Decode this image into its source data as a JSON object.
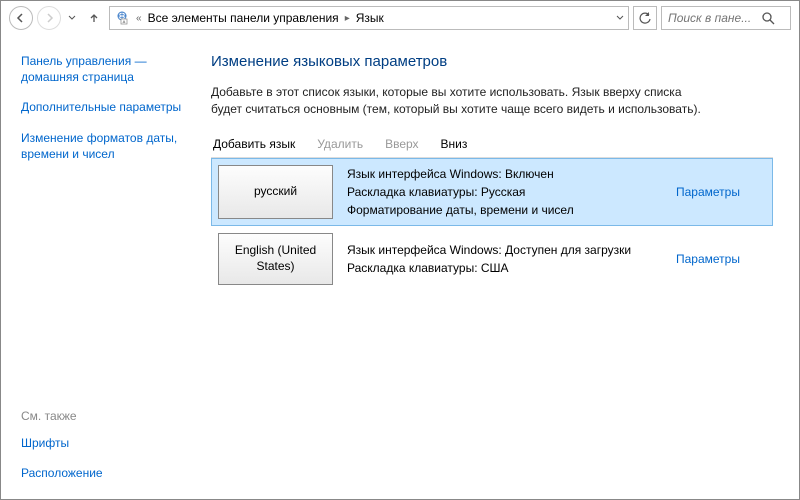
{
  "addressbar": {
    "segment1": "Все элементы панели управления",
    "segment2": "Язык",
    "search_placeholder": "Поиск в пане..."
  },
  "sidebar": {
    "home": "Панель управления — домашняя страница",
    "adv": "Дополнительные параметры",
    "fmt": "Изменение форматов даты, времени и чисел",
    "seealso": "См. также",
    "fonts": "Шрифты",
    "location": "Расположение"
  },
  "main": {
    "title": "Изменение языковых параметров",
    "desc": "Добавьте в этот список языки, которые вы хотите использовать. Язык вверху списка будет считаться основным (тем, который вы хотите чаще всего видеть и использовать).",
    "toolbar": {
      "add": "Добавить язык",
      "remove": "Удалить",
      "up": "Вверх",
      "down": "Вниз"
    },
    "opt_label": "Параметры",
    "languages": [
      {
        "name": "русский",
        "line1": "Язык интерфейса Windows: Включен",
        "line2": "Раскладка клавиатуры: Русская",
        "line3": "Форматирование даты, времени и чисел"
      },
      {
        "name": "English (United States)",
        "line1": "Язык интерфейса Windows: Доступен для загрузки",
        "line2": "Раскладка клавиатуры: США",
        "line3": ""
      }
    ]
  }
}
